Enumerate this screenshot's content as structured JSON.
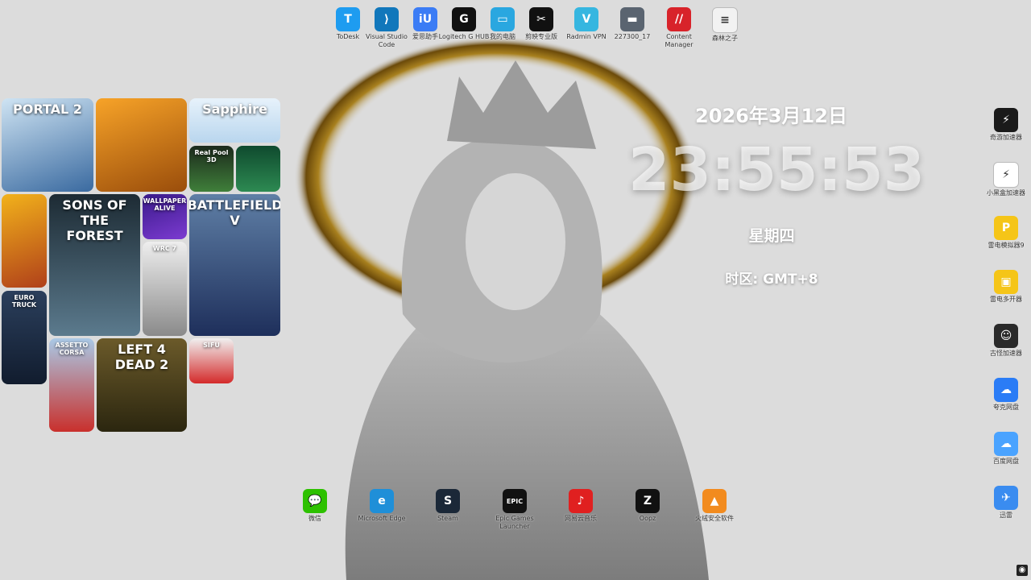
{
  "top_icons": [
    {
      "label": "ToDesk",
      "glyph": "T",
      "color": "#1e9cf0",
      "icon": "todesk-icon"
    },
    {
      "label": "Visual Studio Code",
      "glyph": "⟩",
      "color": "#1177bb",
      "icon": "vscode-icon"
    },
    {
      "label": "爱思助手",
      "glyph": "iU",
      "color": "#3b7cf5",
      "icon": "i4-icon"
    },
    {
      "label": "Logitech G HUB",
      "glyph": "G",
      "color": "#111111",
      "icon": "logitech-icon"
    },
    {
      "label": "我的电脑",
      "glyph": "▭",
      "color": "#2aa7e0",
      "icon": "computer-icon"
    },
    {
      "label": "剪映专业版",
      "glyph": "✂",
      "color": "#111111",
      "icon": "capcut-icon"
    },
    {
      "label": "Radmin VPN",
      "glyph": "V",
      "color": "#36b6e0",
      "icon": "radmin-icon"
    },
    {
      "label": "227300_17",
      "glyph": "▬",
      "color": "#5a6470",
      "icon": "image-file-icon"
    },
    {
      "label": "Content Manager",
      "glyph": "//",
      "color": "#d8232a",
      "icon": "content-manager-icon"
    },
    {
      "label": "森林之子",
      "glyph": "≡",
      "color": "#f2f2f2",
      "icon": "text-file-icon"
    }
  ],
  "bottom_icons": [
    {
      "label": "微信",
      "glyph": "💬",
      "color": "#2dc100",
      "icon": "wechat-icon"
    },
    {
      "label": "Microsoft Edge",
      "glyph": "e",
      "color": "#1f8fd8",
      "icon": "edge-icon"
    },
    {
      "label": "Steam",
      "glyph": "S",
      "color": "#1b2838",
      "icon": "steam-icon"
    },
    {
      "label": "Epic Games Launcher",
      "glyph": "EPIC",
      "color": "#111111",
      "icon": "epic-icon"
    },
    {
      "label": "网易云音乐",
      "glyph": "♪",
      "color": "#e02020",
      "icon": "netease-music-icon"
    },
    {
      "label": "Oopz",
      "glyph": "Z",
      "color": "#111111",
      "icon": "oopz-icon"
    },
    {
      "label": "火绒安全软件",
      "glyph": "▲",
      "color": "#f28b1e",
      "icon": "huorong-icon"
    }
  ],
  "right_icons": [
    {
      "label": "奇游加速器",
      "glyph": "⚡",
      "color": "#1a1a1a",
      "icon": "qiyou-icon"
    },
    {
      "label": "小黑盒加速器",
      "glyph": "⚡",
      "color": "#ffffff",
      "icon": "xiaoheihe-icon"
    },
    {
      "label": "雷电模拟器9",
      "glyph": "P",
      "color": "#f5c518",
      "icon": "ldplayer-icon"
    },
    {
      "label": "雷电多开器",
      "glyph": "▣",
      "color": "#f5c518",
      "icon": "ld-multi-icon"
    },
    {
      "label": "古怪加速器",
      "glyph": "☺",
      "color": "#2a2a2a",
      "icon": "guguai-icon"
    },
    {
      "label": "夸克网盘",
      "glyph": "☁",
      "color": "#2a7cf6",
      "icon": "quark-icon"
    },
    {
      "label": "百度网盘",
      "glyph": "☁",
      "color": "#4aa3ff",
      "icon": "baidu-pan-icon"
    },
    {
      "label": "迅雷",
      "glyph": "✈",
      "color": "#3a8cf0",
      "icon": "xunlei-icon"
    }
  ],
  "tiles": [
    {
      "name": "tile-portal2",
      "text": "PORTAL 2",
      "bg": "linear-gradient(160deg,#cfe4f3,#3a6aa0)"
    },
    {
      "name": "tile-hunt",
      "text": "",
      "bg": "linear-gradient(160deg,#f7a328,#9a4d0b)"
    },
    {
      "name": "tile-sapphire",
      "text": "Sapphire",
      "bg": "linear-gradient(180deg,#e7f2fb,#b9d6ee)"
    },
    {
      "name": "tile-realpool",
      "text": "Real Pool 3D",
      "bg": "linear-gradient(180deg,#1c2a1c,#3f7f3a)"
    },
    {
      "name": "tile-pool-balls",
      "text": "",
      "bg": "linear-gradient(180deg,#0f4a2e,#2d8a52)"
    },
    {
      "name": "tile-street-fighter",
      "text": "",
      "bg": "linear-gradient(160deg,#f2b21b,#b0401a)"
    },
    {
      "name": "tile-sons-of-the-forest",
      "text": "SONS OF THE FOREST",
      "bg": "linear-gradient(180deg,#1d2b34,#5b7a8d)"
    },
    {
      "name": "tile-wallpaper-alive",
      "text": "WALLPAPER ALIVE",
      "bg": "linear-gradient(160deg,#3a1a8a,#7c3bd1)"
    },
    {
      "name": "tile-battlefield-v",
      "text": "BATTLEFIELD V",
      "bg": "linear-gradient(180deg,#5f7fa6,#1e2f5b)"
    },
    {
      "name": "tile-wrc7",
      "text": "WRC 7",
      "bg": "linear-gradient(180deg,#eeeeee,#8a8a8a)"
    },
    {
      "name": "tile-euro-truck",
      "text": "EURO TRUCK",
      "bg": "linear-gradient(180deg,#2b3f5c,#111c2e)"
    },
    {
      "name": "tile-assetto-corsa",
      "text": "ASSETTO CORSA",
      "bg": "linear-gradient(180deg,#a9c9e6,#c9302c)"
    },
    {
      "name": "tile-left4dead2",
      "text": "LEFT 4 DEAD 2",
      "bg": "linear-gradient(180deg,#6b5a2a,#2b260f)"
    },
    {
      "name": "tile-sifu",
      "text": "SIFU",
      "bg": "linear-gradient(180deg,#f0f0f0,#d42a2a)"
    }
  ],
  "clock": {
    "date": "2026年3月12日",
    "time": "23:55:53",
    "weekday": "星期四",
    "timezone": "时区: GMT+8"
  }
}
